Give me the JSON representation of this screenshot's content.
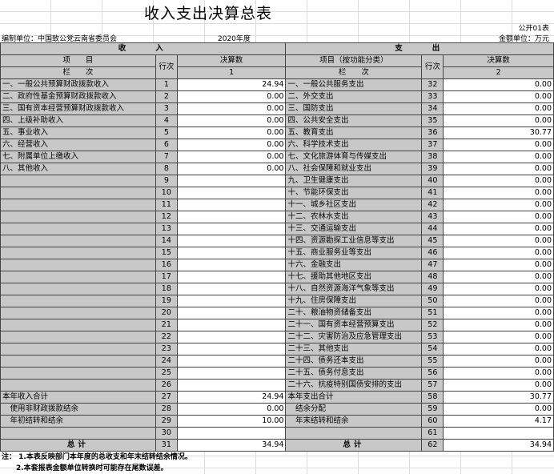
{
  "title": "收入支出决算总表",
  "form_code": "公开01表",
  "unit_label": "编制单位：中国致公党云南省委员会",
  "year": "2020年度",
  "currency_unit": "金额单位：万元",
  "income": {
    "section": "收　　入",
    "col_item": "项　　目",
    "col_row": "行次",
    "col_amount": "决算数",
    "sub_item": "栏　　次",
    "sub_amount": "1"
  },
  "expense": {
    "section": "支　　出",
    "col_item": "项目（按功能分类）",
    "col_row": "行次",
    "col_amount": "决算数",
    "sub_item": "栏　　次",
    "sub_amount": "2"
  },
  "rows": [
    {
      "in_item": "一、一般公共预算财政拨款收入",
      "in_no": "1",
      "in_val": "24.94",
      "ex_item": "一、一般公共服务支出",
      "ex_no": "32",
      "ex_val": "0.00"
    },
    {
      "in_item": "二、政府性基金预算财政拨款收入",
      "in_no": "2",
      "in_val": "0.00",
      "ex_item": "二、外交支出",
      "ex_no": "33",
      "ex_val": "0.00"
    },
    {
      "in_item": "三、国有资本经营预算财政拨款收入",
      "in_no": "3",
      "in_val": "0.00",
      "ex_item": "三、国防支出",
      "ex_no": "34",
      "ex_val": "0.00"
    },
    {
      "in_item": "四、上级补助收入",
      "in_no": "4",
      "in_val": "0.00",
      "ex_item": "四、公共安全支出",
      "ex_no": "35",
      "ex_val": "0.00"
    },
    {
      "in_item": "五、事业收入",
      "in_no": "5",
      "in_val": "0.00",
      "ex_item": "五、教育支出",
      "ex_no": "36",
      "ex_val": "30.77"
    },
    {
      "in_item": "六、经营收入",
      "in_no": "6",
      "in_val": "0.00",
      "ex_item": "六、科学技术支出",
      "ex_no": "37",
      "ex_val": "0.00"
    },
    {
      "in_item": "七、附属单位上缴收入",
      "in_no": "7",
      "in_val": "0.00",
      "ex_item": "七、文化旅游体育与传媒支出",
      "ex_no": "38",
      "ex_val": "0.00"
    },
    {
      "in_item": "八、其他收入",
      "in_no": "8",
      "in_val": "0.00",
      "ex_item": "八、社会保障和就业支出",
      "ex_no": "39",
      "ex_val": "0.00"
    },
    {
      "in_item": "",
      "in_no": "9",
      "in_val": "",
      "ex_item": "九、卫生健康支出",
      "ex_no": "40",
      "ex_val": "0.00"
    },
    {
      "in_item": "",
      "in_no": "10",
      "in_val": "",
      "ex_item": "十、节能环保支出",
      "ex_no": "41",
      "ex_val": "0.00"
    },
    {
      "in_item": "",
      "in_no": "11",
      "in_val": "",
      "ex_item": "十一、城乡社区支出",
      "ex_no": "42",
      "ex_val": "0.00"
    },
    {
      "in_item": "",
      "in_no": "12",
      "in_val": "",
      "ex_item": "十二、农林水支出",
      "ex_no": "43",
      "ex_val": "0.00"
    },
    {
      "in_item": "",
      "in_no": "13",
      "in_val": "",
      "ex_item": "十三、交通运输支出",
      "ex_no": "44",
      "ex_val": "0.00"
    },
    {
      "in_item": "",
      "in_no": "14",
      "in_val": "",
      "ex_item": "十四、资源勘探工业信息等支出",
      "ex_no": "45",
      "ex_val": "0.00"
    },
    {
      "in_item": "",
      "in_no": "15",
      "in_val": "",
      "ex_item": "十五、商业服务业等支出",
      "ex_no": "46",
      "ex_val": "0.00"
    },
    {
      "in_item": "",
      "in_no": "16",
      "in_val": "",
      "ex_item": "十六、金融支出",
      "ex_no": "47",
      "ex_val": "0.00"
    },
    {
      "in_item": "",
      "in_no": "17",
      "in_val": "",
      "ex_item": "十七、援助其他地区支出",
      "ex_no": "48",
      "ex_val": "0.00"
    },
    {
      "in_item": "",
      "in_no": "18",
      "in_val": "",
      "ex_item": "十八、自然资源海洋气象等支出",
      "ex_no": "49",
      "ex_val": "0.00"
    },
    {
      "in_item": "",
      "in_no": "19",
      "in_val": "",
      "ex_item": "十九、住房保障支出",
      "ex_no": "50",
      "ex_val": "0.00"
    },
    {
      "in_item": "",
      "in_no": "20",
      "in_val": "",
      "ex_item": "二十、粮油物资储备支出",
      "ex_no": "51",
      "ex_val": "0.00"
    },
    {
      "in_item": "",
      "in_no": "21",
      "in_val": "",
      "ex_item": "二十一、国有资本经营预算支出",
      "ex_no": "52",
      "ex_val": "0.00"
    },
    {
      "in_item": "",
      "in_no": "22",
      "in_val": "",
      "ex_item": "二十二、灾害防治及应急管理支出",
      "ex_no": "53",
      "ex_val": "0.00"
    },
    {
      "in_item": "",
      "in_no": "23",
      "in_val": "",
      "ex_item": "二十三、其他支出",
      "ex_no": "54",
      "ex_val": "0.00"
    },
    {
      "in_item": "",
      "in_no": "24",
      "in_val": "",
      "ex_item": "二十四、债务还本支出",
      "ex_no": "55",
      "ex_val": "0.00"
    },
    {
      "in_item": "",
      "in_no": "25",
      "in_val": "",
      "ex_item": "二十五、债务付息支出",
      "ex_no": "56",
      "ex_val": "0.00"
    },
    {
      "in_item": "",
      "in_no": "26",
      "in_val": "",
      "ex_item": "二十六、抗疫特别国债安排的支出",
      "ex_no": "57",
      "ex_val": "0.00"
    },
    {
      "in_item": "本年收入合计",
      "in_no": "27",
      "in_val": "24.94",
      "ex_item": "本年支出合计",
      "ex_no": "58",
      "ex_val": "30.77"
    },
    {
      "in_item": "　使用非财政拨款结余",
      "in_no": "28",
      "in_val": "0.00",
      "ex_item": "　结余分配",
      "ex_no": "59",
      "ex_val": "0.00"
    },
    {
      "in_item": "　年初结转和结余",
      "in_no": "29",
      "in_val": "10.00",
      "ex_item": "　年末结转和结余",
      "ex_no": "60",
      "ex_val": "4.17"
    },
    {
      "in_item": "",
      "in_no": "30",
      "in_val": "",
      "ex_item": "",
      "ex_no": "61",
      "ex_val": ""
    }
  ],
  "totals": {
    "in_label": "总计",
    "in_no": "31",
    "in_val": "34.94",
    "ex_label": "总计",
    "ex_no": "62",
    "ex_val": "34.94"
  },
  "notes": [
    "注：  1.本表反映部门本年度的总收支和年末结转结余情况。",
    "2.本套报表金额单位转换时可能存在尾数误差。"
  ]
}
